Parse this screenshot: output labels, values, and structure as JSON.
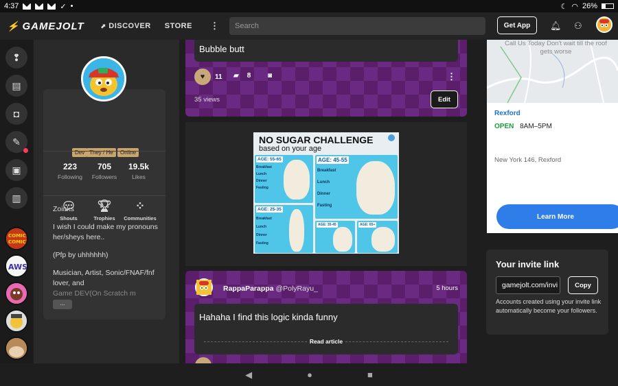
{
  "status_bar": {
    "time": "4:37",
    "battery": "26%"
  },
  "header": {
    "logo": "GAMEJOLT",
    "nav": [
      "DISCOVER",
      "STORE"
    ],
    "search_placeholder": "Search",
    "get_app": "Get App"
  },
  "profile": {
    "tags": [
      "Dev",
      "They / He",
      "Online"
    ],
    "stats": [
      {
        "value": "223",
        "label": "Following"
      },
      {
        "value": "705",
        "label": "Followers"
      },
      {
        "value": "19.5k",
        "label": "Likes"
      }
    ],
    "actions": [
      "Shouts",
      "Trophies",
      "Communities"
    ],
    "bio": [
      "Zoinks",
      "I wish I could make my pronouns her/sheys here..",
      "(Pfp by uhhhhhh)",
      "Musician, Artist, Sonic/FNAF/fnf lover, and",
      "Game DEV(On Scratch m"
    ],
    "more": "..."
  },
  "post1": {
    "text": "Bubble butt",
    "likes": "11",
    "comments": "8",
    "views": "35 views",
    "edit": "Edit"
  },
  "ad": {
    "title": "NO SUGAR CHALLENGE",
    "subtitle": "based on your age",
    "ages": [
      "AGE: 55-65",
      "AGE: 45-55",
      "AGE: 25-35",
      "AGE: 35-45",
      "AGE: 65+"
    ],
    "meals": [
      "Breakfast",
      "Lunch",
      "Dinner",
      "Fasting"
    ]
  },
  "post2": {
    "author": "RappaParappa",
    "handle": "@PolyRayu_",
    "time": "5 hours",
    "text": "Hahaha I find this logic kinda funny",
    "read": "Read article"
  },
  "map_ad": {
    "map_text": "Call Us Today Don't wait till the roof gets worse",
    "location": "Rexford",
    "open_label": "OPEN",
    "hours": "8AM–5PM",
    "address": "New York 146, Rexford",
    "cta": "Learn More"
  },
  "invite": {
    "title": "Your invite link",
    "link": "gamejolt.com/invi",
    "copy": "Copy",
    "description": "Accounts created using your invite link automatically become your followers."
  }
}
